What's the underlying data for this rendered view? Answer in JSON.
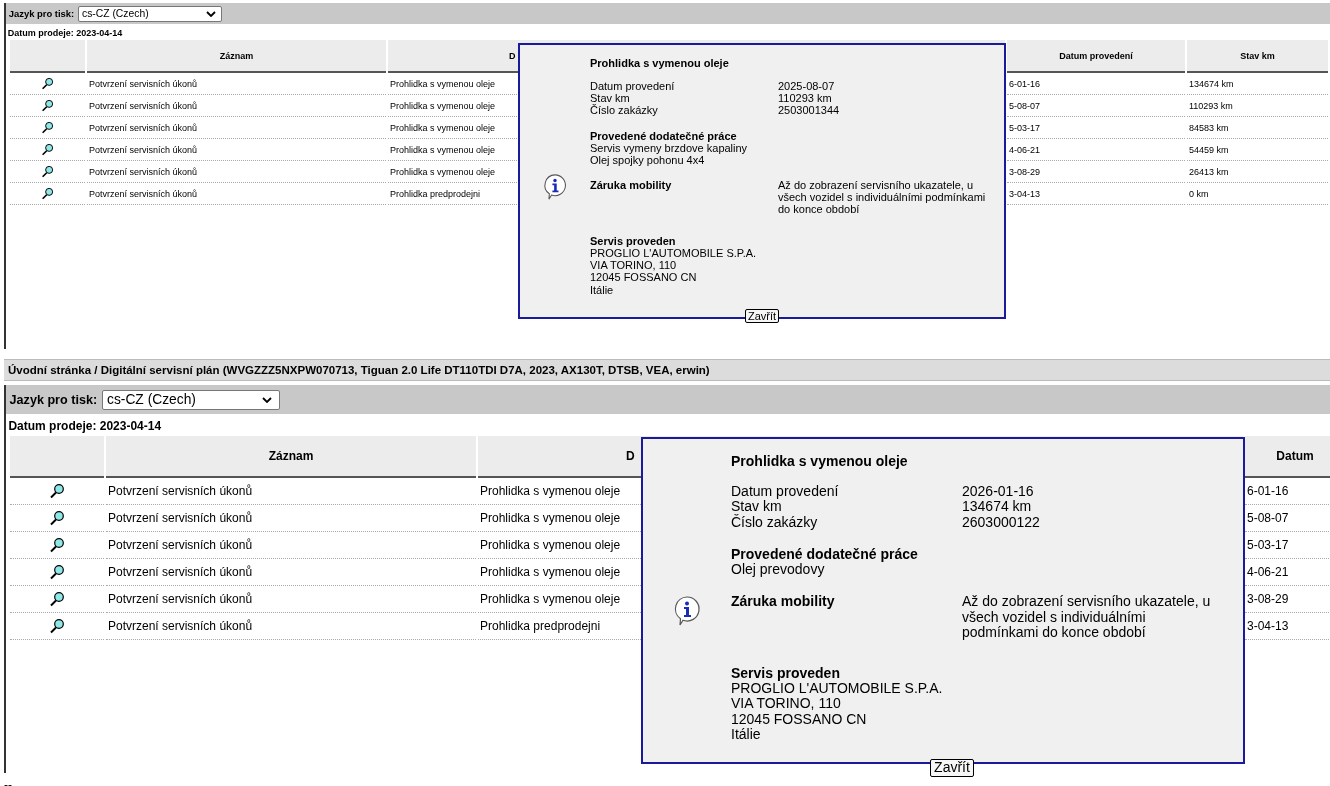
{
  "panels": [
    {
      "language_label": "Jazyk pro tisk:",
      "language": "cs-CZ (Czech)",
      "sale_date": "Datum prodeje: 2023-04-14",
      "table": {
        "columns": [
          "Záznam",
          "D",
          "Datum provedení",
          "Stav km"
        ],
        "rows": [
          {
            "record": "Potvrzení servisních úkonů",
            "description": "Prohlidka s vymenou oleje",
            "date": "6-01-16",
            "mileage": "134674 km"
          },
          {
            "record": "Potvrzení servisních úkonů",
            "description": "Prohlidka s vymenou oleje",
            "date": "5-08-07",
            "mileage": "110293 km"
          },
          {
            "record": "Potvrzení servisních úkonů",
            "description": "Prohlidka s vymenou oleje",
            "date": "5-03-17",
            "mileage": "84583 km"
          },
          {
            "record": "Potvrzení servisních úkonů",
            "description": "Prohlidka s vymenou oleje",
            "date": "4-06-21",
            "mileage": "54459 km"
          },
          {
            "record": "Potvrzení servisních úkonů",
            "description": "Prohlidka s vymenou oleje",
            "date": "3-08-29",
            "mileage": "26413 km"
          },
          {
            "record": "Potvrzení servisních úkonů",
            "description": "Prohlidka predprodejni",
            "date": "3-04-13",
            "mileage": "0 km"
          }
        ]
      },
      "dialog": {
        "title": "Prohlidka s vymenou oleje",
        "fields": [
          {
            "label": "Datum provedení",
            "value": "2025-08-07"
          },
          {
            "label": "Stav km",
            "value": "110293 km"
          },
          {
            "label": "Číslo zakázky",
            "value": "2503001344"
          }
        ],
        "extra_work": {
          "label": "Provedené dodatečné práce",
          "lines": [
            "Servis vymeny brzdove kapaliny",
            "Olej spojky pohonu 4x4"
          ]
        },
        "warranty": {
          "label": "Záruka mobility",
          "value": "Až do zobrazení servisního ukazatele, u všech vozidel s individuálními podmínkami do konce období"
        },
        "performed_by": {
          "label": "Servis proveden",
          "lines": [
            "PROGLIO L'AUTOMOBILE S.P.A.",
            "VIA TORINO, 110",
            "12045 FOSSANO CN",
            "Itálie"
          ]
        },
        "close_button": "Zavřít"
      }
    },
    {
      "breadcrumb": "Úvodní stránka / Digitální servisní plán (WVGZZZ5NXPW070713, Tiguan 2.0 Life DT110TDI D7A, 2023, AX130T, DTSB, VEA, erwin)",
      "language_label": "Jazyk pro tisk:",
      "language": "cs-CZ (Czech)",
      "sale_date": "Datum prodeje: 2023-04-14",
      "table": {
        "columns": [
          "Záznam",
          "D",
          "Datum"
        ],
        "rows": [
          {
            "record": "Potvrzení servisních úkonů",
            "description": "Prohlidka s vymenou oleje",
            "date": "6-01-16"
          },
          {
            "record": "Potvrzení servisních úkonů",
            "description": "Prohlidka s vymenou oleje",
            "date": "5-08-07"
          },
          {
            "record": "Potvrzení servisních úkonů",
            "description": "Prohlidka s vymenou oleje",
            "date": "5-03-17"
          },
          {
            "record": "Potvrzení servisních úkonů",
            "description": "Prohlidka s vymenou oleje",
            "date": "4-06-21"
          },
          {
            "record": "Potvrzení servisních úkonů",
            "description": "Prohlidka s vymenou oleje",
            "date": "3-08-29"
          },
          {
            "record": "Potvrzení servisních úkonů",
            "description": "Prohlidka predprodejni",
            "date": "3-04-13"
          }
        ]
      },
      "dialog": {
        "title": "Prohlidka s vymenou oleje",
        "fields": [
          {
            "label": "Datum provedení",
            "value": "2026-01-16"
          },
          {
            "label": "Stav km",
            "value": "134674 km"
          },
          {
            "label": "Číslo zakázky",
            "value": "2603000122"
          }
        ],
        "extra_work": {
          "label": "Provedené dodatečné práce",
          "lines": [
            "Olej prevodovy"
          ]
        },
        "warranty": {
          "label": "Záruka mobility",
          "value": "Až do zobrazení servisního ukazatele, u všech vozidel s individuálními podmínkami do konce období"
        },
        "performed_by": {
          "label": "Servis proveden",
          "lines": [
            "PROGLIO L'AUTOMOBILE S.P.A.",
            "VIA TORINO, 110",
            "12045 FOSSANO CN",
            "Itálie"
          ]
        },
        "close_button": "Zavřít"
      }
    }
  ],
  "footer": "--"
}
